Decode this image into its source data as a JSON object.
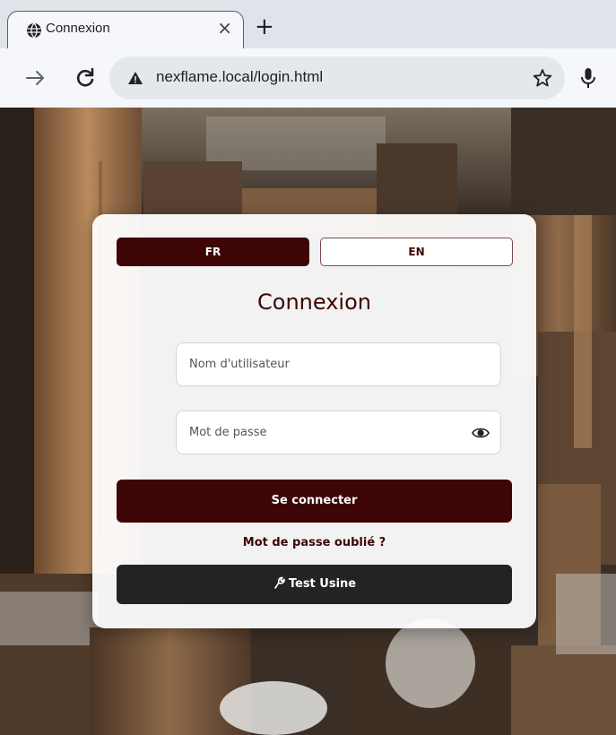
{
  "browser": {
    "tab_title": "Connexion",
    "tab_close_glyph": "×",
    "new_tab_glyph": "+",
    "url": "nexflame.local/login.html",
    "icons": [
      "globe-icon",
      "forward-arrow-icon",
      "reload-icon",
      "warning-icon",
      "star-icon",
      "mic-icon"
    ]
  },
  "login": {
    "lang_fr": "FR",
    "lang_en": "EN",
    "title": "Connexion",
    "username_placeholder": "Nom d'utilisateur",
    "password_placeholder": "Mot de passe",
    "submit_label": "Se connecter",
    "forgot_label": "Mot de passe oublié ?",
    "factory_test_label": "Test Usine",
    "colors": {
      "accent": "#3d0505",
      "dark_button": "#232323"
    }
  }
}
